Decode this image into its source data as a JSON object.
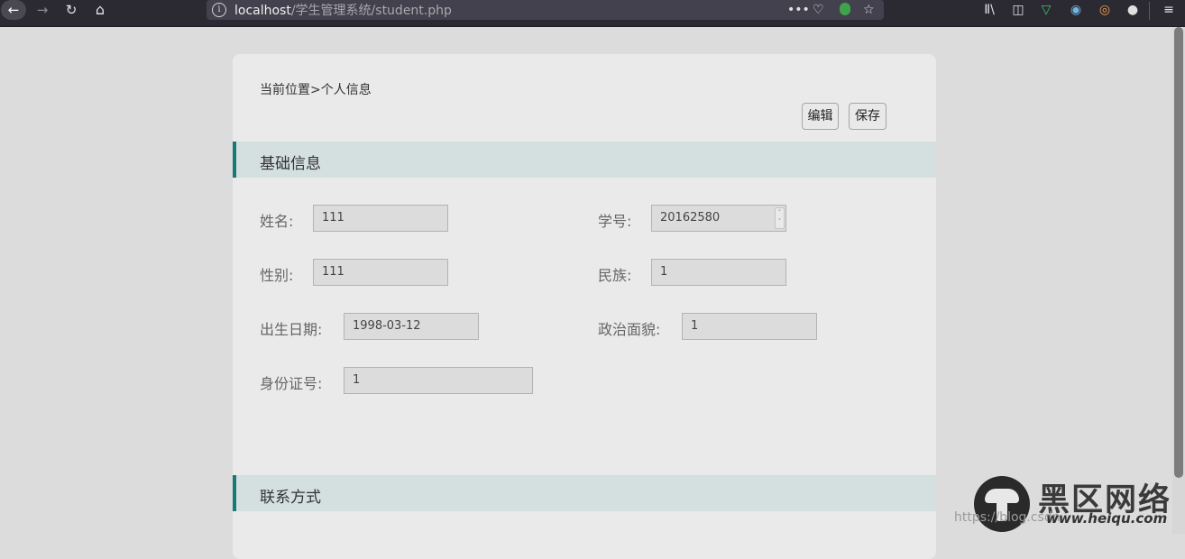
{
  "browser": {
    "url_host": "localhost",
    "url_path": "/学生管理系统/student.php",
    "icons": [
      "back-icon",
      "forward-icon",
      "reload-icon",
      "home-icon",
      "info-icon",
      "more-icon",
      "pocket-icon",
      "bug-icon",
      "star-icon",
      "library-icon",
      "sidebar-icon",
      "extension-icon",
      "extension2-icon",
      "extension3-icon",
      "account-icon",
      "menu-icon"
    ]
  },
  "page": {
    "breadcrumb": "当前位置>个人信息",
    "edit_label": "编辑",
    "save_label": "保存",
    "section_basic": "基础信息",
    "section_contact": "联系方式"
  },
  "form": {
    "name_label": "姓名:",
    "name_value": "111",
    "student_id_label": "学号:",
    "student_id_value": "20162580",
    "gender_label": "性别:",
    "gender_value": "111",
    "ethnicity_label": "民族:",
    "ethnicity_value": "1",
    "birthdate_label": "出生日期:",
    "birthdate_value": "1998-03-12",
    "political_label": "政治面貌:",
    "political_value": "1",
    "idcard_label": "身份证号:",
    "idcard_value": "1"
  },
  "watermark": {
    "brand": "黑区网络",
    "url_dim": "https://blog.csdn",
    "url": "www.heiqu.com"
  },
  "colors": {
    "accent": "#177a78",
    "section_bg": "#d4dfdf",
    "card_bg": "#eaeaea"
  }
}
